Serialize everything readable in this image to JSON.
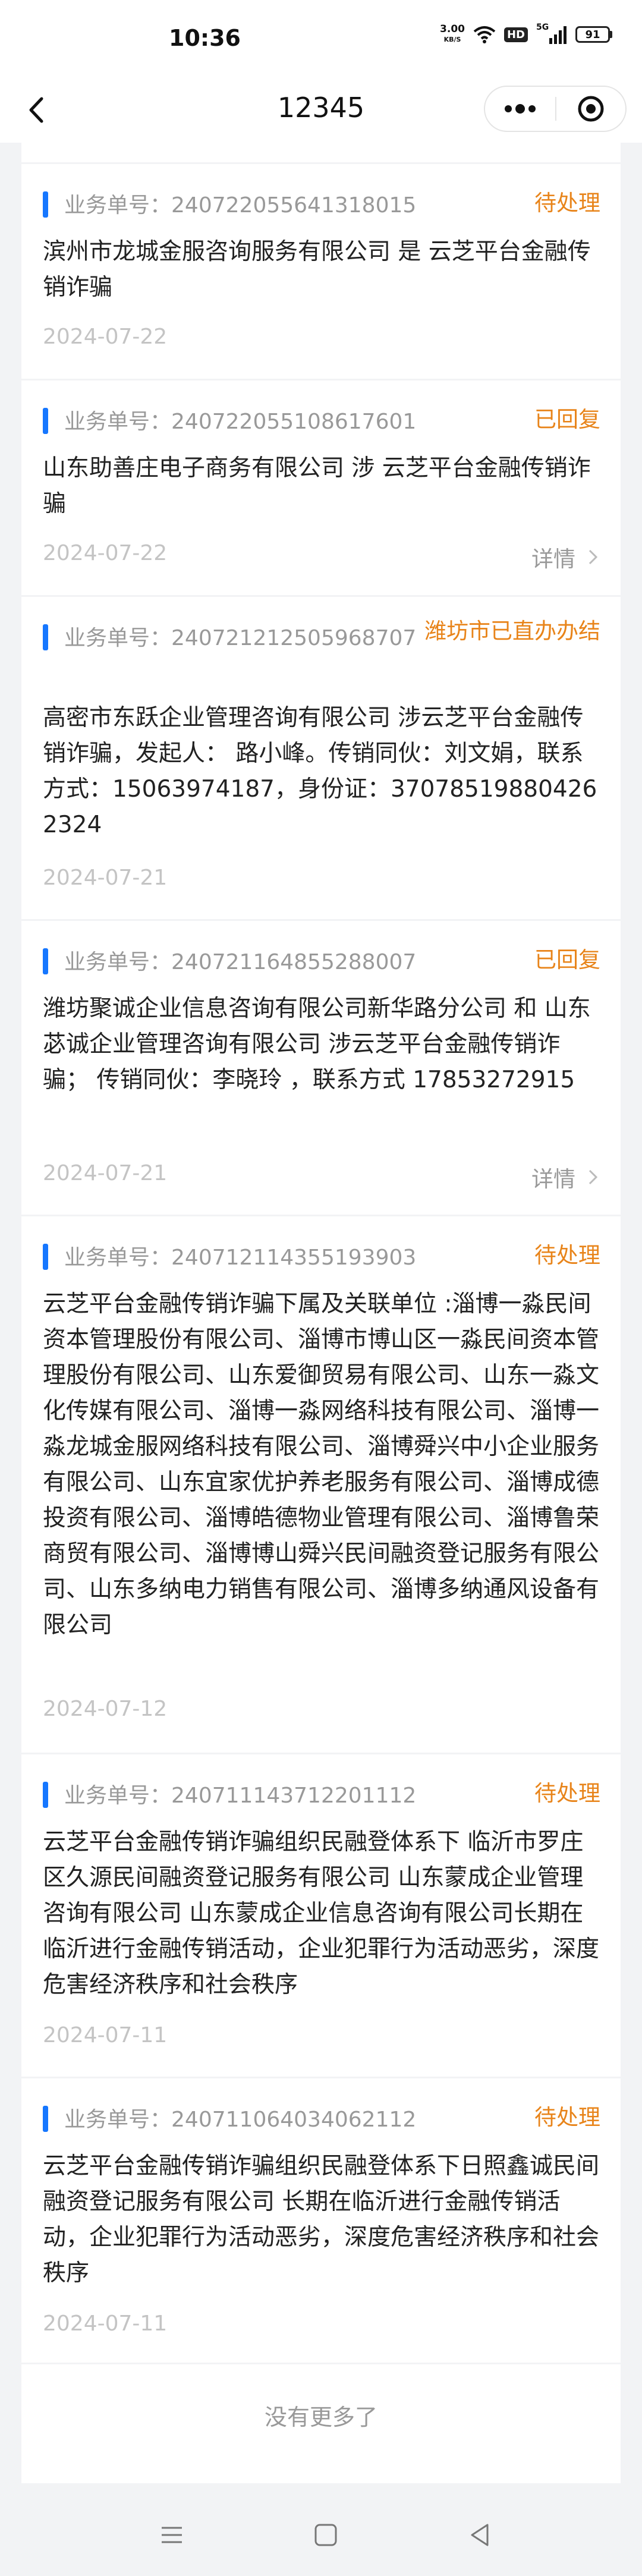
{
  "status_bar": {
    "time": "10:36",
    "net_speed_value": "3.00",
    "net_speed_unit": "KB/S",
    "hd": "HD",
    "signal_label": "5G",
    "battery": "91"
  },
  "nav": {
    "title": "12345",
    "icons": [
      "back-icon",
      "more-icon",
      "close-icon"
    ]
  },
  "list": {
    "order_prefix": "业务单号：",
    "detail_label": "详情",
    "partial_top": {
      "date": "2024-07-22",
      "detail": "详情"
    },
    "items": [
      {
        "order_no": "240722055641318015",
        "status": "待处理",
        "content": "滨州市龙城金服咨询服务有限公司 是 云芝平台金融传销诈骗",
        "date": "2024-07-22",
        "has_detail": false
      },
      {
        "order_no": "240722055108617601",
        "status": "已回复",
        "content": "山东助善庄电子商务有限公司 涉 云芝平台金融传销诈骗",
        "date": "2024-07-22",
        "has_detail": true
      },
      {
        "order_no": "240721212505968707",
        "status": "潍坊市已直办办结",
        "content": "高密市东跃企业管理咨询有限公司 涉云芝平台金融传销诈骗，发起人： 路小峰。传销同伙：刘文娟，联系方式：15063974187，身份证：370785198804262324",
        "date": "2024-07-21",
        "has_detail": false
      },
      {
        "order_no": "240721164855288007",
        "status": "已回复",
        "content": "潍坊聚诚企业信息咨询有限公司新华路分公司 和 山东苾诚企业管理咨询有限公司 涉云芝平台金融传销诈骗； 传销同伙：李晓玲 ，联系方式 17853272915",
        "date": "2024-07-21",
        "has_detail": true
      },
      {
        "order_no": "240712114355193903",
        "status": "待处理",
        "content": "云芝平台金融传销诈骗下属及关联单位 :淄博一淼民间资本管理股份有限公司、淄博市博山区一淼民间资本管理股份有限公司、山东爱御贸易有限公司、山东一淼文化传媒有限公司、淄博一淼网络科技有限公司、淄博一淼龙城金服网络科技有限公司、淄博舜兴中小企业服务有限公司、山东宜家优护养老服务有限公司、淄博成德投资有限公司、淄博皓德物业管理有限公司、淄博鲁荣商贸有限公司、淄博博山舜兴民间融资登记服务有限公司、山东多纳电力销售有限公司、淄博多纳通风设备有限公司",
        "date": "2024-07-12",
        "has_detail": false
      },
      {
        "order_no": "240711143712201112",
        "status": "待处理",
        "content": "云芝平台金融传销诈骗组织民融登体系下 临沂市罗庄区久源民间融资登记服务有限公司 山东蒙成企业管理咨询有限公司 山东蒙成企业信息咨询有限公司长期在临沂进行金融传销活动，企业犯罪行为活动恶劣，深度危害经济秩序和社会秩序",
        "date": "2024-07-11",
        "has_detail": false
      },
      {
        "order_no": "240711064034062112",
        "status": "待处理",
        "content": "云芝平台金融传销诈骗组织民融登体系下日照鑫诚民间融资登记服务有限公司 长期在临沂进行金融传销活动，企业犯罪行为活动恶劣，深度危害经济秩序和社会秩序",
        "date": "2024-07-11",
        "has_detail": false
      }
    ],
    "no_more": "没有更多了"
  },
  "colors": {
    "accent_blue": "#1677ff",
    "status_orange": "#e8841a",
    "date_gray": "#c4c4c4"
  },
  "system_nav": [
    "menu-icon",
    "home-icon",
    "back-triangle-icon"
  ]
}
